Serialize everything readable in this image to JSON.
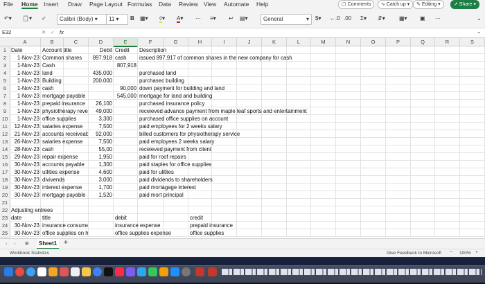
{
  "menu": [
    "File",
    "Home",
    "Insert",
    "Draw",
    "Page Layout",
    "Formulas",
    "Data",
    "Review",
    "View",
    "Automate",
    "Help"
  ],
  "top_buttons": {
    "comments": "Comments",
    "catchup": "Catch up",
    "editing": "Editing",
    "share": "Share"
  },
  "toolbar": {
    "font": "Calibri (Body)",
    "size": "11",
    "bold": "B",
    "format": "General",
    "currency": "$",
    "percent": "%"
  },
  "formula_bar": {
    "name_box": "E32",
    "fx": "fx",
    "value": ""
  },
  "columns": [
    "A",
    "B",
    "C",
    "D",
    "E",
    "F",
    "G",
    "H",
    "I",
    "J",
    "K",
    "L",
    "M",
    "N",
    "O",
    "P",
    "Q",
    "R",
    "S"
  ],
  "selected_column": "E",
  "rows": [
    {
      "n": "1",
      "a": "Date",
      "b": "Account title",
      "d": "Debit",
      "e": "Credit",
      "f": "Description"
    },
    {
      "n": "2",
      "a": "1-Nov-23",
      "b": "Common shares",
      "d": "897,918",
      "e": "cash",
      "f": "issued 897,917 of common shares in the new company for cash"
    },
    {
      "n": "3",
      "a": "1-Nov-23",
      "b": "Cash",
      "d": "",
      "e": "807,918",
      "f": ""
    },
    {
      "n": "4",
      "a": "1-Nov-23",
      "b": "land",
      "d": "435,000",
      "e": "",
      "f": "purchased land"
    },
    {
      "n": "5",
      "a": "1-Nov-23",
      "b": "Building",
      "d": "200,000",
      "e": "",
      "f": "purchasec building"
    },
    {
      "n": "6",
      "a": "1-Nov-23",
      "b": "cash",
      "d": "",
      "e": "90,000",
      "f": "down payment for building and land"
    },
    {
      "n": "7",
      "a": "1-Nov-23",
      "b": "mortgage payable",
      "d": "",
      "e": "545,000",
      "f": "mortgage for land and building"
    },
    {
      "n": "8",
      "a": "1-Nov-23",
      "b": "prepaid insurance",
      "d": "26,100",
      "e": "",
      "f": "purchased insurance policy"
    },
    {
      "n": "9",
      "a": "1-Nov-23",
      "b": "physiotherapy reven",
      "d": "49,000",
      "e": "",
      "f": "receieved advance payment from maple leaf sports and entertainment"
    },
    {
      "n": "10",
      "a": "1-Nov-23",
      "b": "office supplies",
      "d": "3,300",
      "e": "",
      "f": "purchased office supplies on account"
    },
    {
      "n": "11",
      "a": "12-Nov-23",
      "b": "salaries expense",
      "d": "7,500",
      "e": "",
      "f": "paid employees for 2 weeks salary"
    },
    {
      "n": "12",
      "a": "21-Nov-23",
      "b": "accounts receiveable",
      "d": "92,000",
      "e": "",
      "f": "billed customers for physiotherapy service"
    },
    {
      "n": "13",
      "a": "26-Nov-23",
      "b": "salaries expense",
      "d": "7,500",
      "e": "",
      "f": "paid employees 2 weeks salary"
    },
    {
      "n": "14",
      "a": "28-Nov-23",
      "b": "cash",
      "d": "55,00",
      "e": "",
      "f": "receieved payment from client"
    },
    {
      "n": "15",
      "a": "29-Nov-23",
      "b": "repair expense",
      "d": "1,950",
      "e": "",
      "f": "paid for roof repairs"
    },
    {
      "n": "16",
      "a": "30-Nov-23",
      "b": "accounts payable",
      "d": "1,300",
      "e": "",
      "f": "paid staples for office supplies"
    },
    {
      "n": "17",
      "a": "30-Nov-23",
      "b": "utlities expense",
      "d": "4,600",
      "e": "",
      "f": "paid for ulitlies"
    },
    {
      "n": "18",
      "a": "30-Nov-23",
      "b": "divivends",
      "d": "3,000",
      "e": "",
      "f": "paid  dividends to shareholders"
    },
    {
      "n": "19",
      "a": "30-Nov-23",
      "b": "interest expense",
      "d": "1,700",
      "e": "",
      "f": "paid mortagage interest"
    },
    {
      "n": "20",
      "a": "30-Nov-23",
      "b": "mortgage payable",
      "d": "1,520",
      "e": "",
      "f": "paid mort principal"
    },
    {
      "n": "21",
      "a": "",
      "b": "",
      "d": "",
      "e": "",
      "f": ""
    },
    {
      "n": "22",
      "a": "Adjusting entrees",
      "b": "",
      "d": "",
      "e": "",
      "f": ""
    },
    {
      "n": "23",
      "a": "date",
      "b": "title",
      "d": "",
      "e": "debit",
      "f": "",
      "h": "credit"
    },
    {
      "n": "24",
      "a": "30-Nov-23",
      "b": "insurance  consumed",
      "d": "",
      "e": "insurance expense",
      "f": "",
      "h": "prepaid insurance"
    },
    {
      "n": "25",
      "a": "30-Nov-23",
      "b": "office supplies on hand",
      "d": "",
      "e": "office supplies expense",
      "f": "",
      "h": "office supplies"
    }
  ],
  "sheet_tab": "Sheet1",
  "status": {
    "left": "Workbook Statistics",
    "feedback": "Give Feedback to Microsoft",
    "zoom": "100%"
  }
}
